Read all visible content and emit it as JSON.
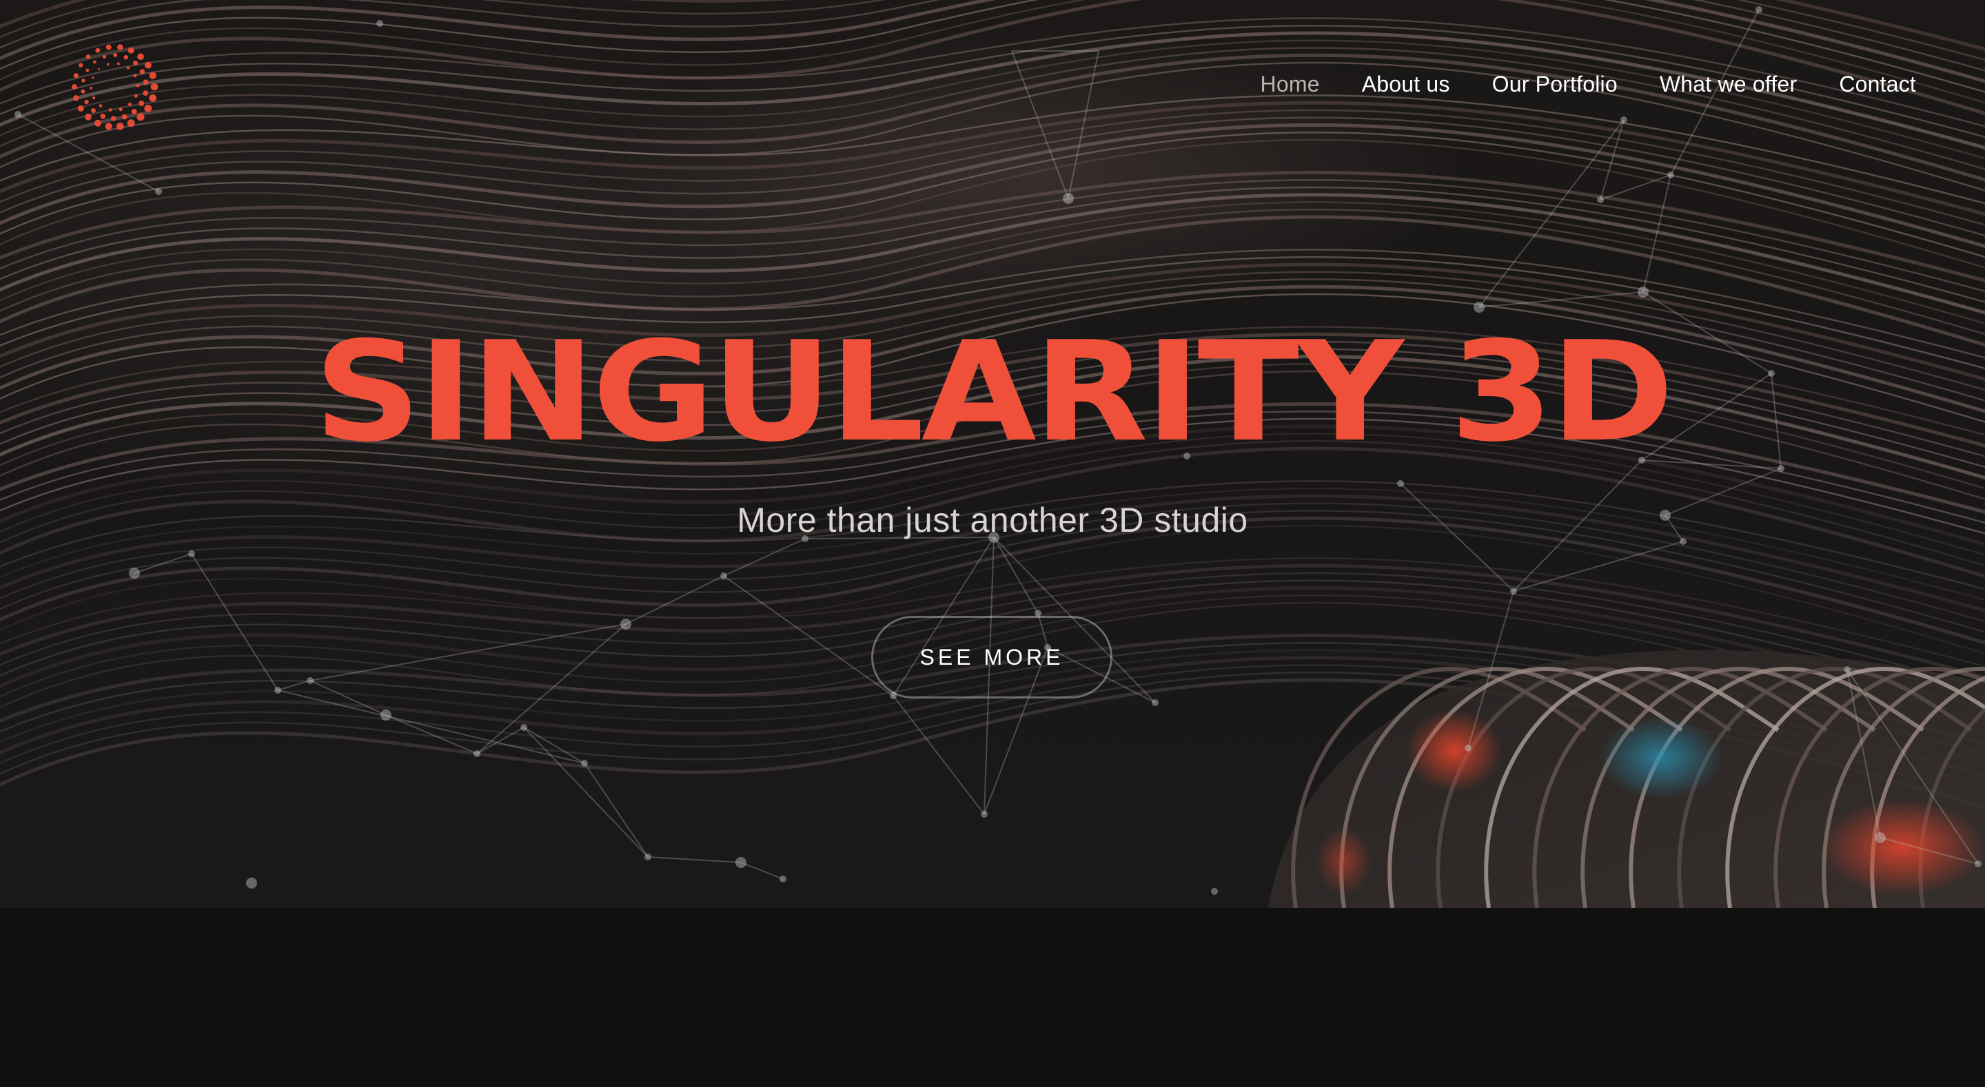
{
  "brand": {
    "logo_icon": "dotted-ring-logo-icon",
    "accent_color": "#f0503a"
  },
  "nav": {
    "items": [
      {
        "label": "Home",
        "active": true
      },
      {
        "label": "About us",
        "active": false
      },
      {
        "label": "Our Portfolio",
        "active": false
      },
      {
        "label": "What we offer",
        "active": false
      },
      {
        "label": "Contact",
        "active": false
      }
    ]
  },
  "hero": {
    "title": "SINGULARITY 3D",
    "subtitle": "More than just another 3D studio",
    "cta_label": "SEE MORE"
  },
  "colors": {
    "hero_background": "#1a1817",
    "page_background": "#0f0f10",
    "nav_text": "#ffffff",
    "nav_active_text": "#b9b5b3"
  }
}
